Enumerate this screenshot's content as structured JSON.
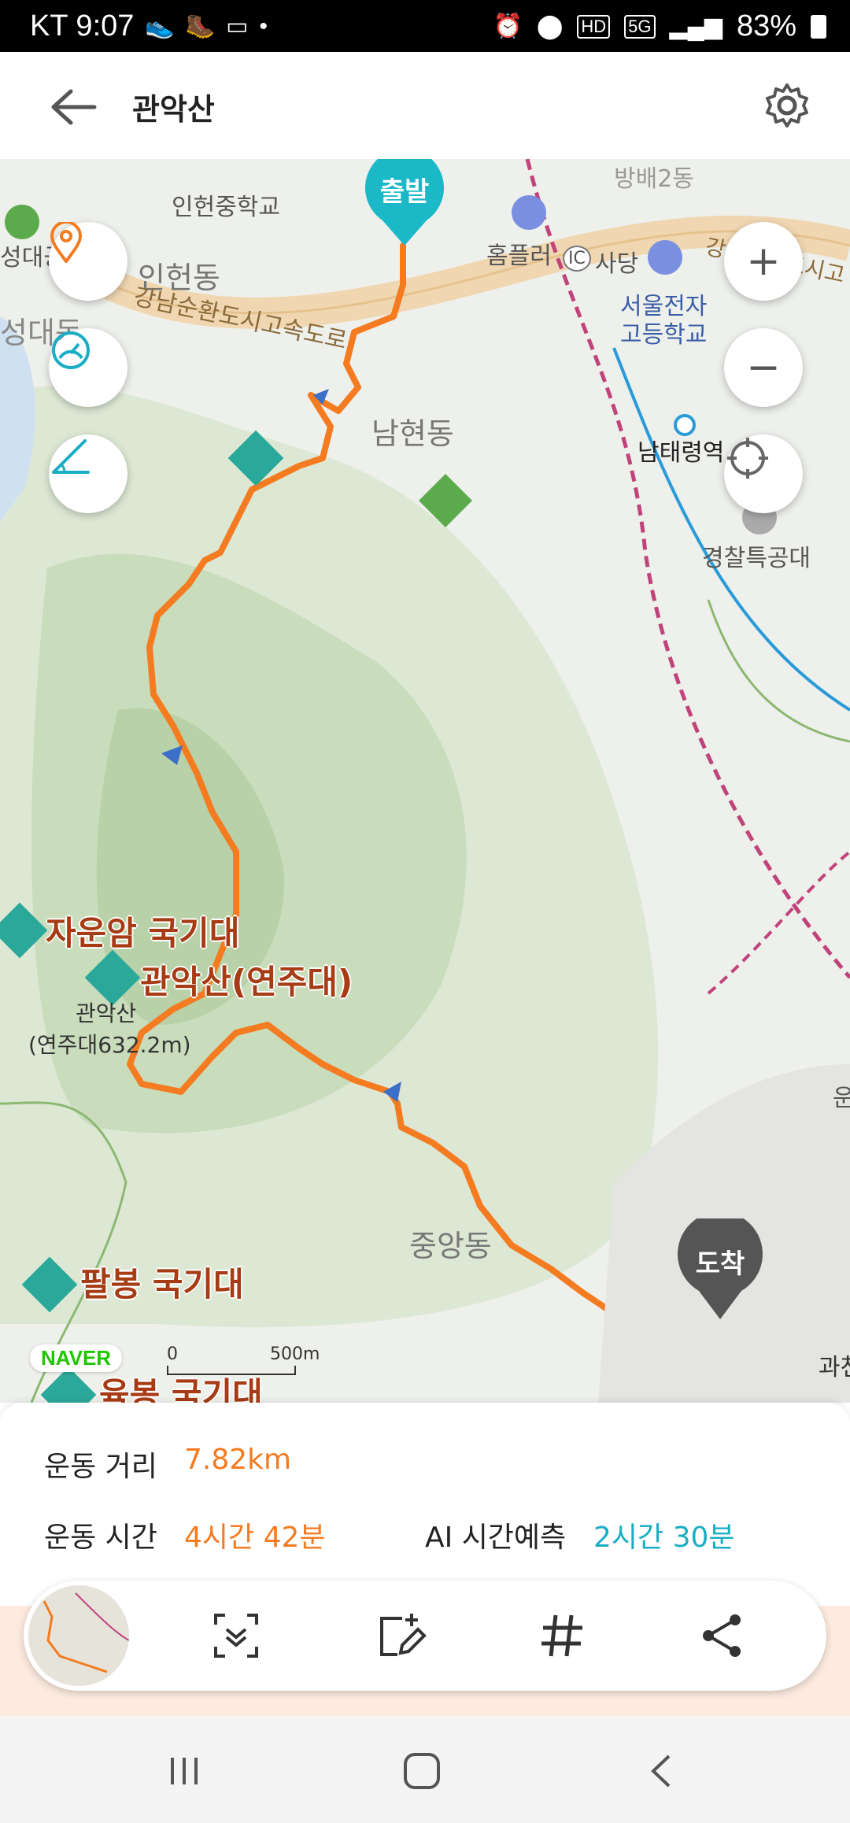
{
  "status_bar": {
    "carrier_time": "KT 9:07",
    "battery": "83%",
    "network": "5G",
    "hd": "HD"
  },
  "header": {
    "title": "관악산",
    "back_icon": "arrow-left-icon",
    "settings_icon": "gear-icon"
  },
  "map": {
    "start_marker": "출발",
    "end_marker": "도착",
    "labels": {
      "school1": "인헌중학교",
      "dong1": "인헌동",
      "park": "성대공",
      "dong2": "성대동",
      "highway": "강남순환도시고속도로",
      "highway2": "강남순환도시고",
      "homeplus": "홈플러",
      "ic": "IC",
      "sadang": "사당",
      "school2": "서울전자\n고등학교",
      "school2_line1": "서울전자",
      "school2_line2": "고등학교",
      "namhyeon": "남현동",
      "station": "남태령역",
      "police": "경찰특공대",
      "namae": "방배2동",
      "jaunam": "자운암 국기대",
      "gwanak_poi": "관악산(연주대)",
      "gwanak_peak1": "관악산",
      "gwanak_peak2": "(연주대632.2m)",
      "jungang": "중앙동",
      "palbong": "팔봉 국기대",
      "yukbong": "육봉 국기대",
      "gwacheon": "과천",
      "un": "운"
    },
    "naver_badge": "NAVER",
    "scale_start": "0",
    "scale_end": "500m",
    "route_color": "#f47b20"
  },
  "map_controls": {
    "zoom_in": "+",
    "zoom_out": "−"
  },
  "stats": {
    "distance_label": "운동 거리",
    "distance_value": "7.82km",
    "time_label": "운동 시간",
    "time_value": "4시간 42분",
    "ai_label": "AI 시간예측",
    "ai_value": "2시간 30분"
  },
  "colors": {
    "accent_orange": "#f47b20",
    "accent_teal": "#1aadc4",
    "start_pin": "#1bb8c8",
    "end_pin": "#555555"
  }
}
